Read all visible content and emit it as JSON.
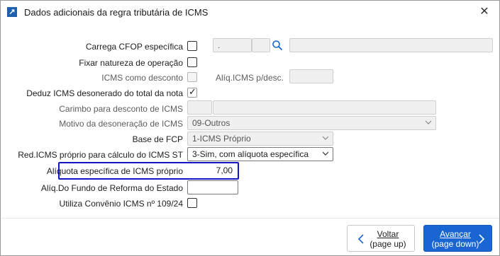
{
  "dialog": {
    "title": "Dados adicionais da regra tributária de ICMS",
    "close": "✕",
    "app_icon": "↗"
  },
  "rows": {
    "carrega_cfop": {
      "label": "Carrega CFOP específica",
      "code1": ".",
      "code2": "",
      "desc": "",
      "icon": "search-icon"
    },
    "fixar_natureza": {
      "label": "Fixar natureza de operação"
    },
    "icms_desconto": {
      "label": "ICMS como desconto",
      "aliq_label": "Alíq.ICMS p/desc.",
      "aliq_value": ""
    },
    "deduz_icms": {
      "label": "Deduz ICMS desonerado do total da nota",
      "checked": true
    },
    "carimbo": {
      "label": "Carimbo para desconto de ICMS",
      "code": "",
      "desc": ""
    },
    "motivo": {
      "label": "Motivo da desoneração de ICMS",
      "value": "09-Outros"
    },
    "base_fcp": {
      "label": "Base de FCP",
      "value": "1-ICMS Próprio"
    },
    "red_icms": {
      "label": "Red.ICMS próprio para cálculo do ICMS ST",
      "value": "3-Sim, com alíquota específica"
    },
    "aliquota_especifica": {
      "label": "Alíquota específica de ICMS próprio",
      "value": "7,00"
    },
    "aliq_fundo": {
      "label": "Alíq.Do Fundo de Reforma do Estado",
      "value": ""
    },
    "convenio": {
      "label": "Utiliza Convênio ICMS nº 109/24"
    }
  },
  "buttons": {
    "back": {
      "label": "Voltar",
      "sub": "(page up)"
    },
    "next": {
      "label": "Avançar",
      "sub": "(page down)"
    }
  },
  "colors": {
    "highlight": "#1515c8",
    "primary": "#1966d2"
  }
}
